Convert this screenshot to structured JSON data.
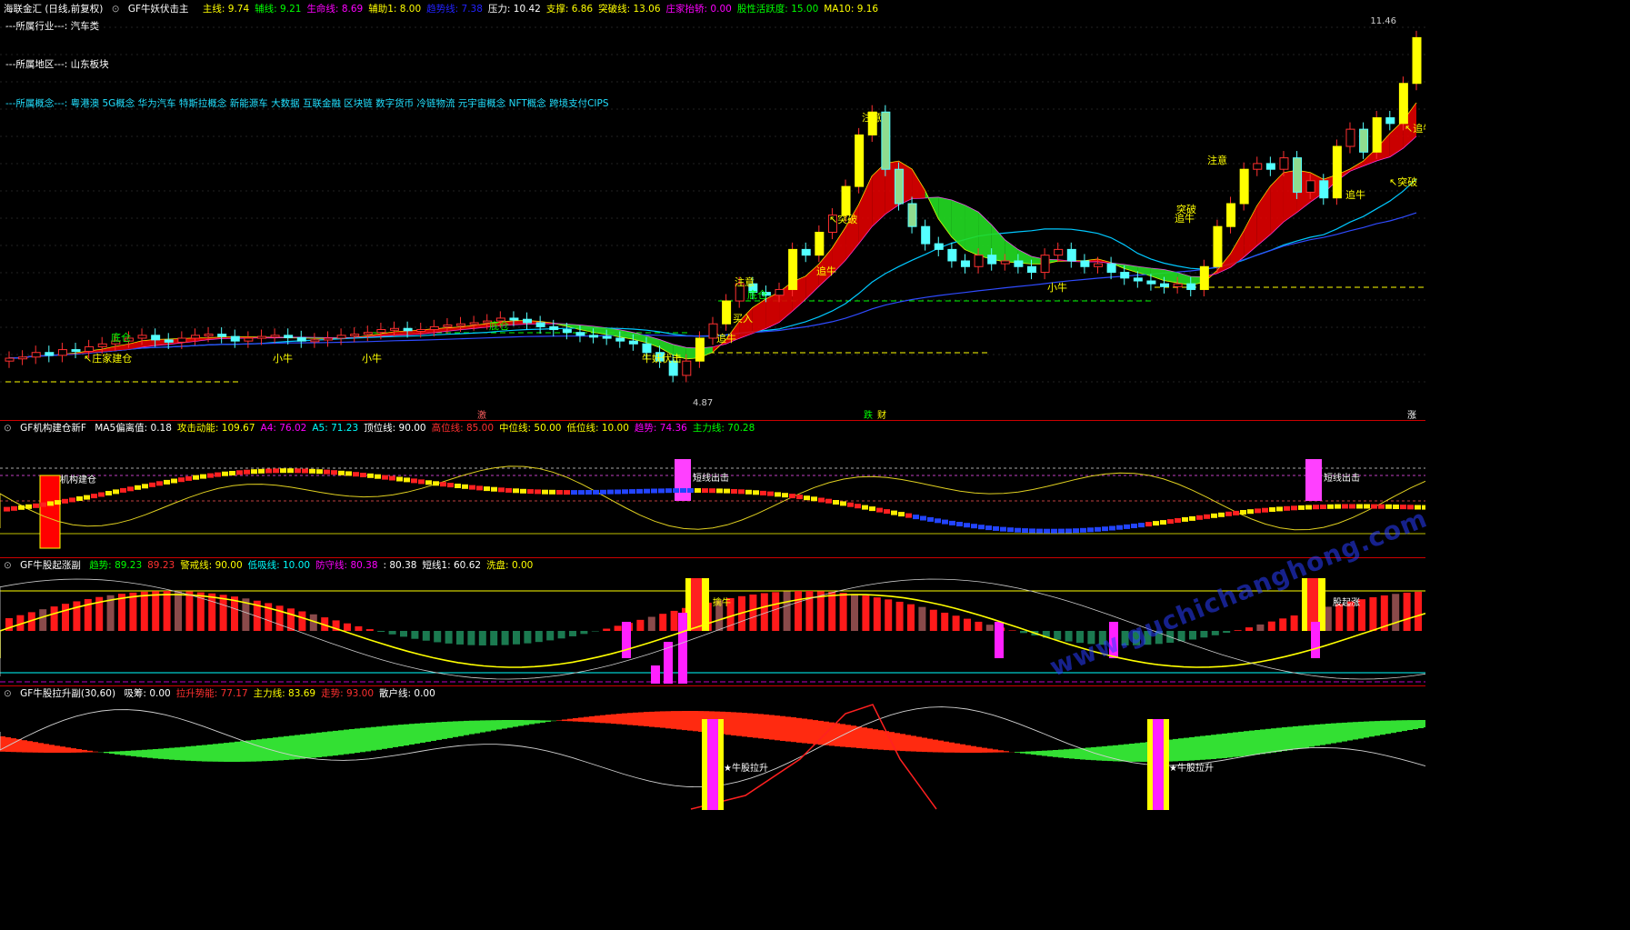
{
  "header": {
    "app_title": "海联金汇 (日线,前复权)",
    "indicator": "GF牛妖伏击主",
    "items": [
      {
        "label": "主线: ",
        "value": "9.74",
        "color": "#ffff00"
      },
      {
        "label": "辅线: ",
        "value": "9.21",
        "color": "#00ff00"
      },
      {
        "label": "生命线: ",
        "value": "8.69",
        "color": "#ff00ff"
      },
      {
        "label": "辅助1: ",
        "value": "8.00",
        "color": "#ffff00"
      },
      {
        "label": "趋势线: ",
        "value": "7.38",
        "color": "#2222ff"
      },
      {
        "label": "压力: ",
        "value": "10.42",
        "color": "#ffffff"
      },
      {
        "label": "支撑: ",
        "value": "6.86",
        "color": "#ffff00"
      },
      {
        "label": "突破线: ",
        "value": "13.06",
        "color": "#ffff00"
      },
      {
        "label": "庄家抬轿: ",
        "value": "0.00",
        "color": "#ff00ff"
      },
      {
        "label": "股性活跃度: ",
        "value": "15.00",
        "color": "#00ff00"
      },
      {
        "label": "MA10: ",
        "value": "9.16",
        "color": "#ffff00"
      }
    ]
  },
  "info": {
    "industry": "---所属行业---:  汽车类",
    "region": "---所属地区---:  山东板块",
    "concepts": "---所属概念---:  粤港澳 5G概念 华为汽车 特斯拉概念 新能源车 大数据 互联金融 区块链 数字货币 冷链物流 元宇宙概念 NFT概念 跨境支付CIPS"
  },
  "price_labels": {
    "high": "11.46",
    "low": "4.87"
  },
  "axis_marks": [
    {
      "text": "激",
      "color": "#ff6060"
    },
    {
      "text": "跌",
      "color": "#00ff00"
    },
    {
      "text": "财",
      "color": "#ffff00"
    },
    {
      "text": "涨",
      "color": "#ffffff"
    }
  ],
  "chart_annotations": [
    {
      "text": "底仓",
      "color": "#00ff00"
    },
    {
      "text": "↖庄家建仓",
      "color": "#ffff00"
    },
    {
      "text": "小牛",
      "color": "#ffff00"
    },
    {
      "text": "小牛",
      "color": "#ffff00"
    },
    {
      "text": "底仓",
      "color": "#00ff00"
    },
    {
      "text": "牛妖伏击",
      "color": "#ffff00"
    },
    {
      "text": "追牛",
      "color": "#ffff00"
    },
    {
      "text": "买入",
      "color": "#ffff00"
    },
    {
      "text": "注意",
      "color": "#ffff00"
    },
    {
      "text": "底仓",
      "color": "#00ff00"
    },
    {
      "text": "追牛",
      "color": "#ffff00"
    },
    {
      "text": "↖突破",
      "color": "#ffff00"
    },
    {
      "text": "注意",
      "color": "#ffff00"
    },
    {
      "text": "小牛",
      "color": "#ffff00"
    },
    {
      "text": "突破",
      "color": "#ffff00"
    },
    {
      "text": "追牛",
      "color": "#ffff00"
    },
    {
      "text": "注意",
      "color": "#ffff00"
    },
    {
      "text": "追牛",
      "color": "#ffff00"
    },
    {
      "text": "↖突破",
      "color": "#ffff00"
    },
    {
      "text": "↖追牛",
      "color": "#ffff00"
    }
  ],
  "panel2": {
    "title": "GF机构建仓新F",
    "items": [
      {
        "label": "MA5偏离值: ",
        "value": "0.18",
        "color": "#ffffff"
      },
      {
        "label": "攻击动能: ",
        "value": "109.67",
        "color": "#ffff00"
      },
      {
        "label": "A4: ",
        "value": "76.02",
        "color": "#ff00ff"
      },
      {
        "label": "A5: ",
        "value": "71.23",
        "color": "#00ffff"
      },
      {
        "label": "顶位线: ",
        "value": "90.00",
        "color": "#ffffff"
      },
      {
        "label": "高位线: ",
        "value": "85.00",
        "color": "#ff3030"
      },
      {
        "label": "中位线: ",
        "value": "50.00",
        "color": "#ffff00"
      },
      {
        "label": "低位线: ",
        "value": "10.00",
        "color": "#ffff00"
      },
      {
        "label": "趋势: ",
        "value": "74.36",
        "color": "#ff00ff"
      },
      {
        "label": "主力线: ",
        "value": "70.28",
        "color": "#00ff00"
      }
    ],
    "labels": [
      {
        "text": "机构建仓",
        "color": "#ffffff"
      },
      {
        "text": "短线出击",
        "color": "#ffffff"
      },
      {
        "text": "短线出击",
        "color": "#ffffff"
      }
    ]
  },
  "panel3": {
    "title": "GF牛股起涨副",
    "items": [
      {
        "label": "趋势: ",
        "value": "89.23",
        "color": "#00ff00"
      },
      {
        "label": "",
        "value": "89.23",
        "color": "#ff3030"
      },
      {
        "label": "警戒线: ",
        "value": "90.00",
        "color": "#ffff00"
      },
      {
        "label": "低吸线: ",
        "value": "10.00",
        "color": "#00ffff"
      },
      {
        "label": "防守线: ",
        "value": "80.38",
        "color": "#ff00ff"
      },
      {
        "label": ": ",
        "value": "80.38",
        "color": "#ffffff"
      },
      {
        "label": "短线1: ",
        "value": "60.62",
        "color": "#ffffff"
      },
      {
        "label": "洗盘: ",
        "value": "0.00",
        "color": "#ffff00"
      }
    ],
    "labels": [
      {
        "text": "擒牛",
        "color": "#ffff00"
      },
      {
        "text": "股起涨",
        "color": "#ffffff"
      }
    ]
  },
  "panel4": {
    "title": "GF牛股拉升副(30,60)",
    "items": [
      {
        "label": "吸筹: ",
        "value": "0.00",
        "color": "#ffffff"
      },
      {
        "label": "拉升势能: ",
        "value": "77.17",
        "color": "#ff3030"
      },
      {
        "label": "主力线: ",
        "value": "83.69",
        "color": "#ffff00"
      },
      {
        "label": "走势: ",
        "value": "93.00",
        "color": "#ff3030"
      },
      {
        "label": "散户线: ",
        "value": "0.00",
        "color": "#ffffff"
      }
    ],
    "labels": [
      {
        "text": "★牛股拉升",
        "color": "#ffffff"
      },
      {
        "text": "★牛股拉升",
        "color": "#ffffff"
      }
    ]
  },
  "watermark": "www.guchichanghong.com",
  "chart_data": {
    "type": "candlestick",
    "y_range": [
      4.87,
      11.46
    ],
    "closes": [
      5.6,
      5.62,
      5.7,
      5.65,
      5.75,
      5.72,
      5.8,
      5.85,
      5.9,
      5.95,
      6.0,
      5.92,
      5.88,
      5.95,
      6.0,
      6.02,
      5.98,
      5.9,
      5.95,
      5.98,
      6.0,
      5.96,
      5.9,
      5.92,
      5.95,
      6.0,
      6.02,
      6.05,
      6.1,
      6.12,
      6.08,
      6.1,
      6.15,
      6.18,
      6.2,
      6.22,
      6.25,
      6.3,
      6.28,
      6.22,
      6.15,
      6.1,
      6.05,
      6.0,
      5.98,
      5.95,
      5.9,
      5.85,
      5.7,
      5.55,
      5.3,
      5.55,
      5.95,
      6.2,
      6.6,
      6.9,
      6.75,
      6.7,
      6.8,
      7.5,
      7.4,
      7.8,
      8.1,
      8.6,
      9.5,
      9.9,
      8.9,
      8.3,
      7.9,
      7.6,
      7.5,
      7.3,
      7.2,
      7.4,
      7.25,
      7.3,
      7.2,
      7.1,
      7.4,
      7.5,
      7.3,
      7.2,
      7.25,
      7.1,
      7.0,
      6.95,
      6.9,
      6.85,
      6.9,
      6.8,
      7.2,
      7.9,
      8.3,
      8.9,
      9.0,
      8.9,
      9.1,
      8.5,
      8.7,
      8.4,
      9.3,
      9.6,
      9.2,
      9.8,
      9.7,
      10.4,
      11.2
    ]
  }
}
